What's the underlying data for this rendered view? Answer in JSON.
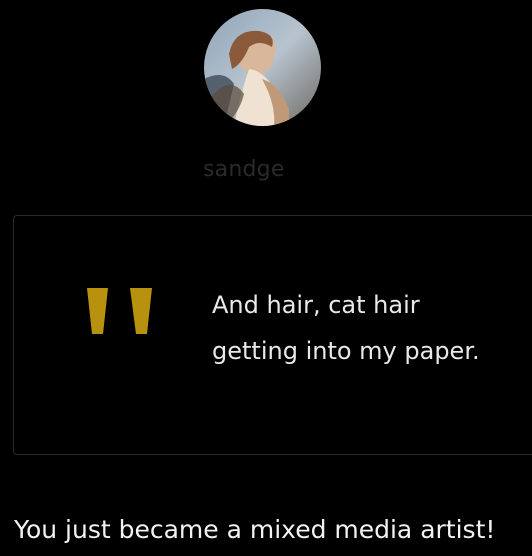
{
  "profile": {
    "avatar_icon": "user-avatar-watercolor-portrait",
    "username": "sandge"
  },
  "quote": {
    "icon": "quote-mark-icon",
    "accent_color": "#b8920f",
    "text": "And hair, cat hair\ngetting into my paper."
  },
  "reply": {
    "text": "You just became a mixed media artist!"
  }
}
